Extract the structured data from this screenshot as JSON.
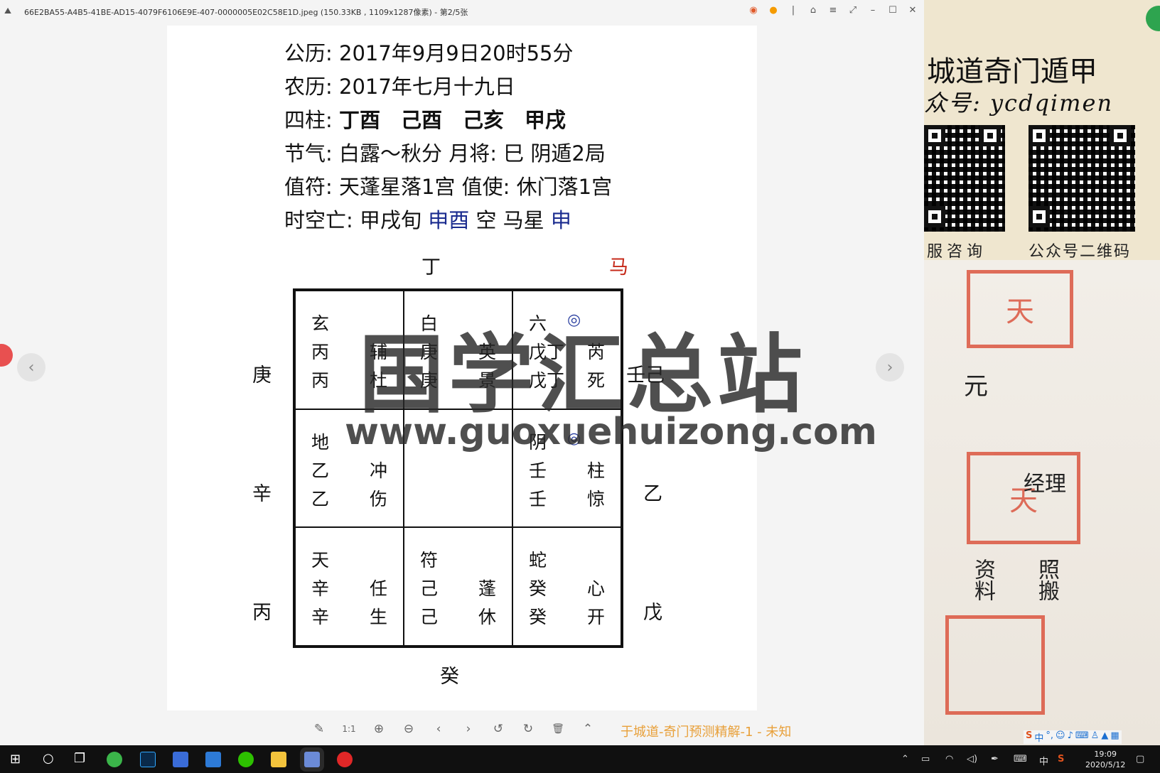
{
  "window": {
    "title": "66E2BA55-A4B5-41BE-AD15-4079F6106E9E-407-0000005E02C58E1D.jpeg (150.33KB , 1109x1287像素) - 第2/5张"
  },
  "chart": {
    "gregorian": "公历: 2017年9月9日20时55分",
    "lunar": "农历: 2017年七月十九日",
    "pillars_label": "四柱: ",
    "pillars": "丁酉　己酉　己亥　甲戌",
    "solar_term": "节气: 白露～秋分 月将: 巳 阴遁2局",
    "duty": "值符: 天蓬星落1宫 值使: 休门落1宫",
    "void_prefix": "时空亡: 甲戌旬 ",
    "void_branches": "申酉",
    "void_mid": " 空 马星 ",
    "horse_branch": "申"
  },
  "directions": {
    "top": "丁",
    "horse": "马",
    "left_top": "庚",
    "left_mid": "辛",
    "left_bottom": "丙",
    "right_top": "壬己",
    "right_mid": "乙",
    "right_bottom": "戊",
    "bottom": "癸"
  },
  "palaces": [
    {
      "god": "玄",
      "heaven": "丙",
      "earth": "丙",
      "star": "辅",
      "door": "杜"
    },
    {
      "god": "白",
      "heaven": "庚",
      "earth": "庚",
      "star": "英",
      "door": "景"
    },
    {
      "god": "六",
      "heaven": "戊丁",
      "earth": "戊丁",
      "star": "芮",
      "door": "死"
    },
    {
      "god": "地",
      "heaven": "乙",
      "earth": "乙",
      "star": "冲",
      "door": "伤"
    },
    {
      "god": "",
      "heaven": "",
      "earth": "",
      "star": "",
      "door": ""
    },
    {
      "god": "阴",
      "heaven": "壬",
      "earth": "壬",
      "star": "柱",
      "door": "惊"
    },
    {
      "god": "天",
      "heaven": "辛",
      "earth": "辛",
      "star": "任",
      "door": "生"
    },
    {
      "god": "符",
      "heaven": "己",
      "earth": "己",
      "star": "蓬",
      "door": "休"
    },
    {
      "god": "蛇",
      "heaven": "癸",
      "earth": "癸",
      "star": "心",
      "door": "开"
    }
  ],
  "marker": "◎",
  "watermark": {
    "title": "国学汇总站",
    "url": "www.guoxuehuizong.com"
  },
  "caption": "于城道-奇门预测精解-1 - 未知",
  "toolbar": {
    "edit": "✎",
    "actual": "1:1",
    "zoom_in": "⊕",
    "zoom_out": "⊖",
    "prev": "‹",
    "next": "›",
    "rot_l": "↺",
    "rot_r": "↻",
    "delete": "🗑",
    "up": "⌃"
  },
  "side": {
    "title": "城道奇门遁甲",
    "subtitle": "众号: ycdqimen",
    "qr_label_left": "服咨询",
    "qr_label_right": "公众号二维码",
    "seal_char_1": "天",
    "seal_char_2": "天",
    "ink_1": "元",
    "ink_2": "经理",
    "ink_3": "资料",
    "ink_4": "照搬"
  },
  "taskbar": {
    "ime": "中",
    "time": "19:09",
    "date": "2020/5/12"
  },
  "colors": {
    "blue_text": "#1a2b8f",
    "red_text": "#c62a1a",
    "caption": "#e8a03a"
  }
}
